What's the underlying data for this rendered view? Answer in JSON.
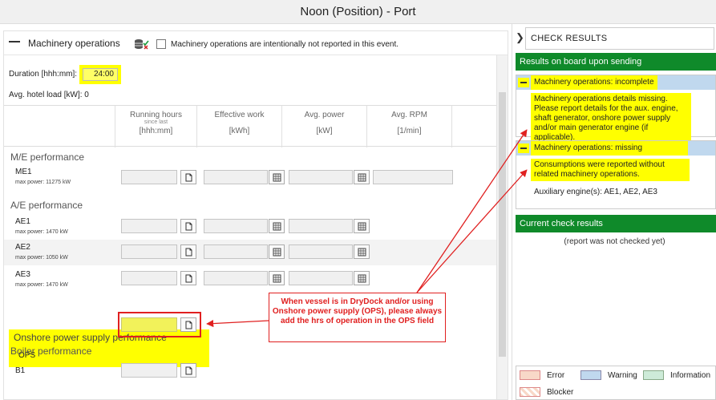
{
  "window": {
    "title": "Noon (Position) - Port"
  },
  "section": {
    "title": "Machinery operations",
    "not_reported_label": "Machinery operations are intentionally not reported in this event."
  },
  "duration": {
    "label": "Duration [hhh:mm]:",
    "value": "24:00"
  },
  "hotel_load": "Avg. hotel load [kW]: 0",
  "columns": [
    {
      "title": "Running hours",
      "sub": "since last",
      "unit": "[hhh:mm]"
    },
    {
      "title": "Effective work",
      "sub": "",
      "unit": "[kWh]"
    },
    {
      "title": "Avg. power",
      "sub": "",
      "unit": "[kW]"
    },
    {
      "title": "Avg. RPM",
      "sub": "",
      "unit": "[1/min]"
    }
  ],
  "groups": {
    "me": {
      "title": "M/E performance",
      "rows": [
        {
          "name": "ME1",
          "max": "max power: 11275 kW"
        }
      ]
    },
    "ae": {
      "title": "A/E performance",
      "rows": [
        {
          "name": "AE1",
          "max": "max power: 1470 kW"
        },
        {
          "name": "AE2",
          "max": "max power: 1050 kW"
        },
        {
          "name": "AE3",
          "max": "max power: 1470 kW"
        }
      ]
    },
    "ops": {
      "title": "Onshore power supply performance",
      "rows": [
        {
          "name": "OPS"
        }
      ]
    },
    "boiler": {
      "title": "Boiler performance",
      "rows": [
        {
          "name": "B1"
        }
      ]
    }
  },
  "callout": "When vessel is in DryDock and/or using Onshore power supply (OPS), please always add the hrs of operation in the OPS field",
  "check_panel": {
    "title": "CHECK RESULTS",
    "onboard_header": "Results on board upon sending",
    "cards": [
      {
        "title": "Machinery operations: incomplete",
        "message": "Machinery operations details missing. Please report details for the aux. engine, shaft generator, onshore power supply and/or main generator engine (if applicable)."
      },
      {
        "title": "Machinery operations: missing",
        "message": "Consumptions were reported without related machinery operations.",
        "extra": "Auxiliary engine(s): AE1, AE2, AE3"
      }
    ],
    "current_header": "Current check results",
    "not_checked": "(report was not checked yet)"
  },
  "legend": [
    {
      "label": "Error",
      "color": "#f8d8c8"
    },
    {
      "label": "Warning",
      "color": "#c0d8ee"
    },
    {
      "label": "Information",
      "color": "#cdebd8"
    },
    {
      "label": "Blocker",
      "color": "#f8d8c8"
    }
  ],
  "colors": {
    "highlight": "#ffff00",
    "green": "#0f8a2a",
    "warning": "#c0d8ee",
    "red": "#e02020"
  }
}
